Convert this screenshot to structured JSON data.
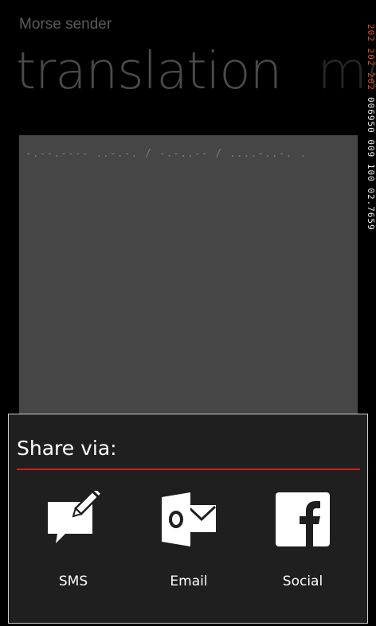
{
  "app": {
    "title": "Morse sender"
  },
  "pivot": {
    "tabs": [
      {
        "label": "translation"
      },
      {
        "label": "me"
      }
    ]
  },
  "morse": {
    "text": "-.--.---- ..-.-. / -.-..-- / ....-..-. ."
  },
  "debug": {
    "red_digits": "202 202 202",
    "white_digits": "006950 009 100 02.7659"
  },
  "share": {
    "title": "Share via:",
    "options": [
      {
        "label": "SMS",
        "icon": "sms-icon"
      },
      {
        "label": "Email",
        "icon": "outlook-email-icon"
      },
      {
        "label": "Social",
        "icon": "facebook-icon"
      }
    ]
  },
  "colors": {
    "accent": "#c8201f",
    "panel": "#1f1f1f",
    "text_area": "#464646",
    "debug_red": "#d4541f"
  }
}
